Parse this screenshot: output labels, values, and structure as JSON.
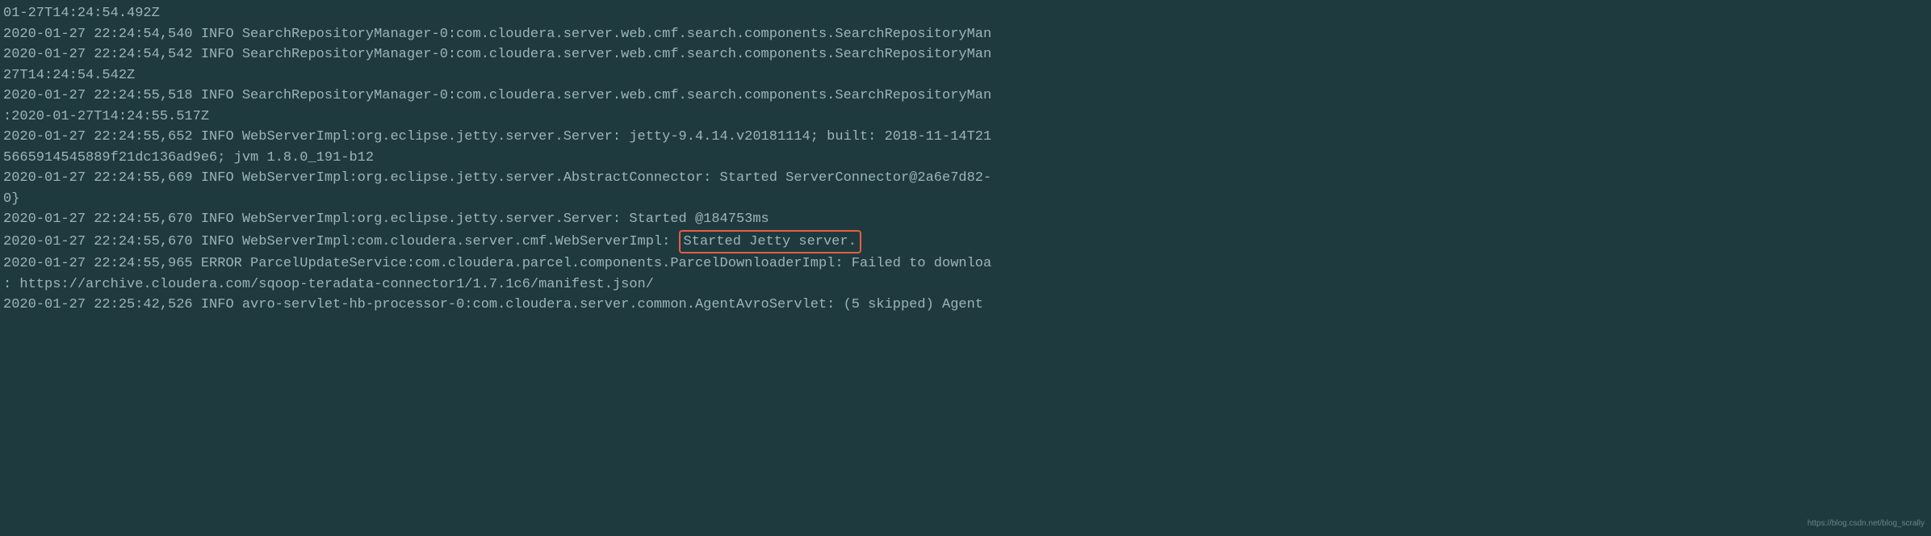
{
  "log": {
    "lines": [
      "01-27T14:24:54.492Z",
      "2020-01-27 22:24:54,540 INFO SearchRepositoryManager-0:com.cloudera.server.web.cmf.search.components.SearchRepositoryMan",
      "2020-01-27 22:24:54,542 INFO SearchRepositoryManager-0:com.cloudera.server.web.cmf.search.components.SearchRepositoryMan",
      "27T14:24:54.542Z",
      "2020-01-27 22:24:55,518 INFO SearchRepositoryManager-0:com.cloudera.server.web.cmf.search.components.SearchRepositoryMan",
      ":2020-01-27T14:24:55.517Z",
      "2020-01-27 22:24:55,652 INFO WebServerImpl:org.eclipse.jetty.server.Server: jetty-9.4.14.v20181114; built: 2018-11-14T21",
      "5665914545889f21dc136ad9e6; jvm 1.8.0_191-b12",
      "2020-01-27 22:24:55,669 INFO WebServerImpl:org.eclipse.jetty.server.AbstractConnector: Started ServerConnector@2a6e7d82-",
      "0}",
      "2020-01-27 22:24:55,670 INFO WebServerImpl:org.eclipse.jetty.server.Server: Started @184753ms"
    ],
    "highlighted_line": {
      "prefix": "2020-01-27 22:24:55,670 INFO WebServerImpl:com.cloudera.server.cmf.WebServerImpl: ",
      "highlighted": "Started Jetty server."
    },
    "after_lines": [
      "2020-01-27 22:24:55,965 ERROR ParcelUpdateService:com.cloudera.parcel.components.ParcelDownloaderImpl: Failed to downloa",
      ": https://archive.cloudera.com/sqoop-teradata-connector1/1.7.1c6/manifest.json/",
      "2020-01-27 22:25:42,526 INFO avro-servlet-hb-processor-0:com.cloudera.server.common.AgentAvroServlet: (5 skipped) Agent"
    ]
  },
  "watermark": "https://blog.csdn.net/blog_scrally"
}
